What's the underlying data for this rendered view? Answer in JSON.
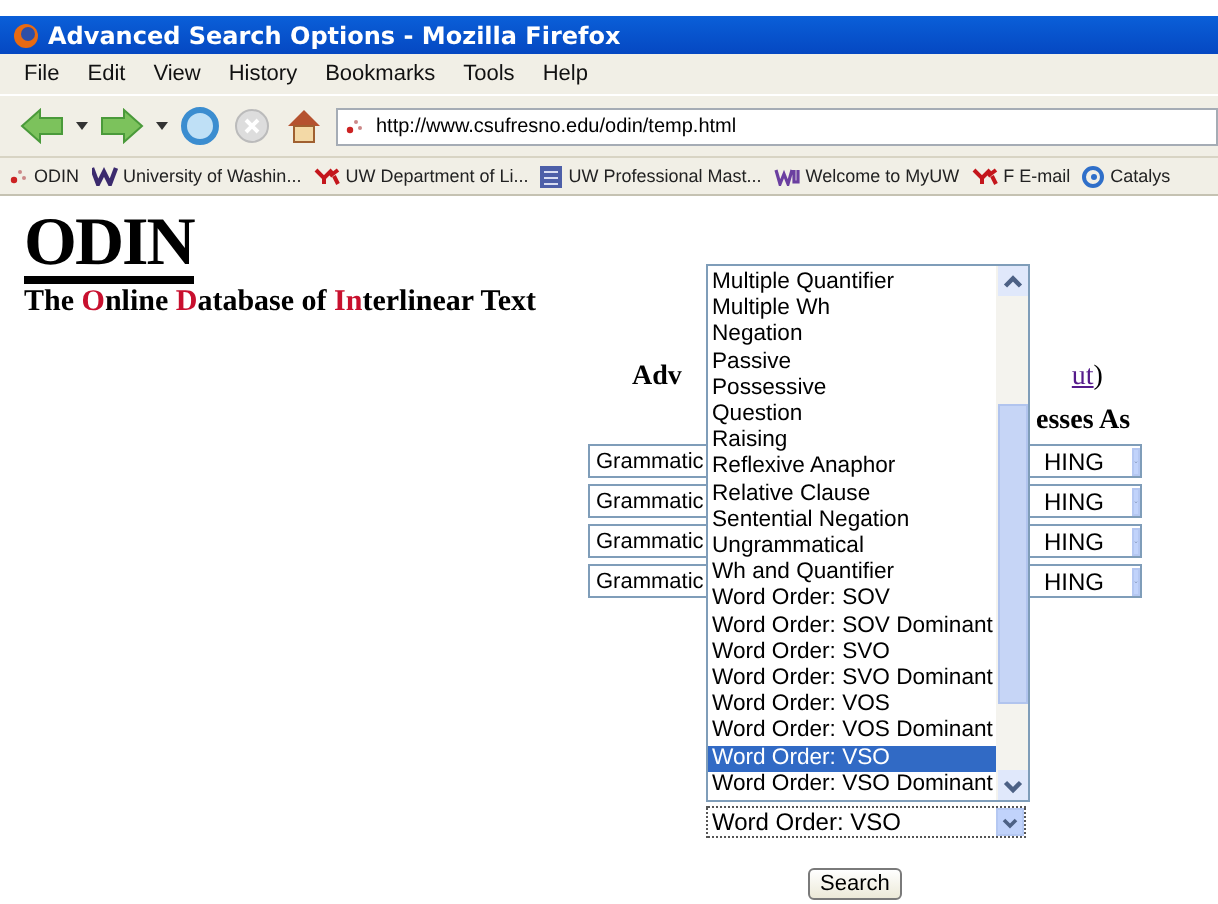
{
  "window": {
    "title": "Advanced Search Options - Mozilla Firefox"
  },
  "menu": [
    {
      "label": "File"
    },
    {
      "label": "Edit"
    },
    {
      "label": "View"
    },
    {
      "label": "History"
    },
    {
      "label": "Bookmarks"
    },
    {
      "label": "Tools"
    },
    {
      "label": "Help"
    }
  ],
  "toolbar": {
    "url": "http://www.csufresno.edu/odin/temp.html"
  },
  "bookmarks": [
    {
      "label": "ODIN",
      "kind": "dots"
    },
    {
      "label": "University of Washin...",
      "kind": "w"
    },
    {
      "label": "UW Department of Li...",
      "kind": "y"
    },
    {
      "label": "UW Professional Mast...",
      "kind": "grid"
    },
    {
      "label": "Welcome to MyUW",
      "kind": "uw"
    },
    {
      "label": "F E-mail",
      "kind": "y"
    },
    {
      "label": "Catalys",
      "kind": "swirl"
    }
  ],
  "page": {
    "logo": "ODIN",
    "tagline": [
      {
        "text": "The ",
        "highlight": false
      },
      {
        "text": "O",
        "highlight": true
      },
      {
        "text": "nline ",
        "highlight": false
      },
      {
        "text": "D",
        "highlight": true
      },
      {
        "text": "atabase of ",
        "highlight": false
      },
      {
        "text": "In",
        "highlight": true
      },
      {
        "text": "terlinear Text",
        "highlight": false
      }
    ],
    "heading": "Adv",
    "heading_link": "ut",
    "heading_paren": ")",
    "column_header": "esses As",
    "rows": [
      {
        "left": "Grammatic",
        "right": "HING"
      },
      {
        "left": "Grammatic",
        "right": "HING"
      },
      {
        "left": "Grammatic",
        "right": "HING"
      },
      {
        "left": "Grammatic",
        "right": "HING"
      }
    ],
    "dropdown": {
      "value": "Word Order: VSO",
      "options": [
        {
          "label": "Multiple Quantifier",
          "selected": false
        },
        {
          "label": "Multiple Wh",
          "selected": false
        },
        {
          "label": "Negation",
          "selected": false
        },
        {
          "label": "Passive",
          "selected": false
        },
        {
          "label": "Possessive",
          "selected": false
        },
        {
          "label": "Question",
          "selected": false
        },
        {
          "label": "Raising",
          "selected": false
        },
        {
          "label": "Reflexive Anaphor",
          "selected": false
        },
        {
          "label": "Relative Clause",
          "selected": false
        },
        {
          "label": "Sentential Negation",
          "selected": false
        },
        {
          "label": "Ungrammatical",
          "selected": false
        },
        {
          "label": "Wh and Quantifier",
          "selected": false
        },
        {
          "label": "Word Order: SOV",
          "selected": false
        },
        {
          "label": "Word Order: SOV Dominant",
          "selected": false
        },
        {
          "label": "Word Order: SVO",
          "selected": false
        },
        {
          "label": "Word Order: SVO Dominant",
          "selected": false
        },
        {
          "label": "Word Order: VOS",
          "selected": false
        },
        {
          "label": "Word Order: VOS Dominant",
          "selected": false
        },
        {
          "label": "Word Order: VSO",
          "selected": true
        },
        {
          "label": "Word Order: VSO Dominant",
          "selected": false
        }
      ]
    },
    "search_button": "Search"
  }
}
